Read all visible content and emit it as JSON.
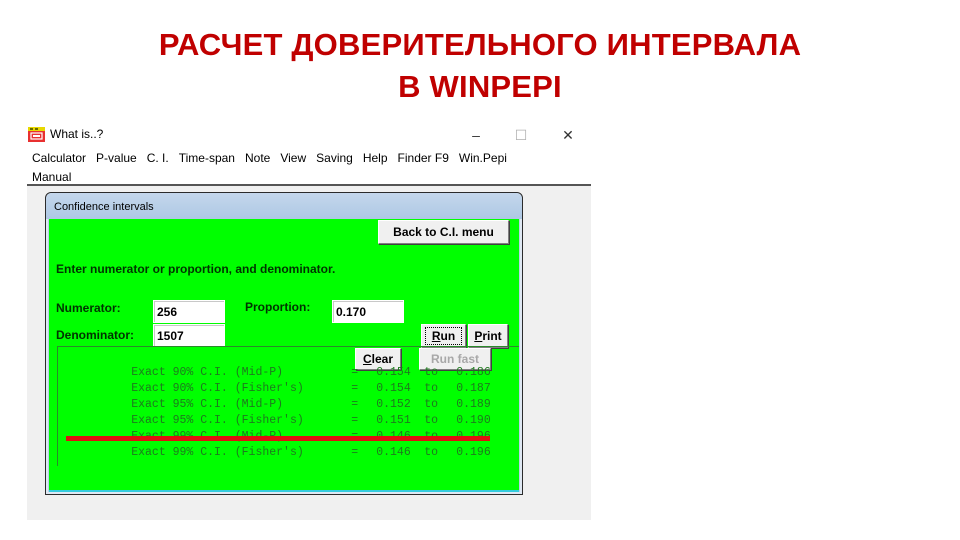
{
  "slide": {
    "title_line1": "РАСЧЕТ ДОВЕРИТЕЛЬНОГО ИНТЕРВАЛА",
    "title_line2": "В WINPEPI",
    "title_color": "#c00000"
  },
  "app": {
    "window_title": "What is..?",
    "window_controls": {
      "minimize": "–",
      "maximize": "☐",
      "close": "✕"
    },
    "menu_row1": [
      "Calculator",
      "P-value",
      "C. I.",
      "Time-span",
      "Note",
      "View",
      "Saving",
      "Help",
      "Finder F9",
      "Win.Pepi"
    ],
    "menu_row2": [
      "Manual"
    ]
  },
  "dialog": {
    "title": "Confidence intervals",
    "background_color": "#00ff00",
    "back_button": "Back to C.I. menu",
    "instruction": "Enter numerator or proportion, and denominator.",
    "numerator_label": "Numerator:",
    "numerator_value": "256",
    "denominator_label": "Denominator:",
    "denominator_value": "1507",
    "proportion_label": "Proportion:",
    "proportion_value": "0.170",
    "run_button_accel": "R",
    "run_button_rest": "un",
    "print_button_accel": "P",
    "print_button_rest": "rint",
    "clear_button_accel": "C",
    "clear_button_rest": "lear",
    "run_fast_button": "Run fast",
    "results": [
      {
        "label": "Exact 90% C.I. (Mid-P)",
        "eq": "=",
        "lower": "0.154",
        "to": "to",
        "upper": "0.186"
      },
      {
        "label": "Exact 90% C.I. (Fisher's)",
        "eq": "=",
        "lower": "0.154",
        "to": "to",
        "upper": "0.187"
      },
      {
        "label": "Exact 95% C.I. (Mid-P)",
        "eq": "=",
        "lower": "0.152",
        "to": "to",
        "upper": "0.189"
      },
      {
        "label": "Exact 95% C.I. (Fisher's)",
        "eq": "=",
        "lower": "0.151",
        "to": "to",
        "upper": "0.190"
      },
      {
        "label": "Exact 99% C.I. (Mid-P)",
        "eq": "=",
        "lower": "0.146",
        "to": "to",
        "upper": "0.196"
      },
      {
        "label": "Exact 99% C.I. (Fisher's)",
        "eq": "=",
        "lower": "0.146",
        "to": "to",
        "upper": "0.196"
      }
    ],
    "highlight_color": "#e01010"
  }
}
